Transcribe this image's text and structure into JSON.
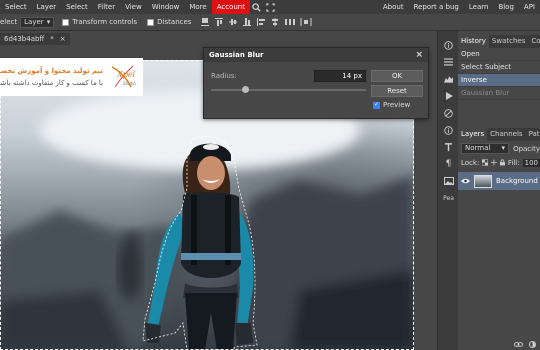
{
  "menu": {
    "items": [
      "Select",
      "Layer",
      "Select",
      "Filter",
      "View",
      "Window",
      "More",
      "Account"
    ],
    "right_items": [
      "About",
      "Report a bug",
      "Learn",
      "Blog",
      "API"
    ],
    "accent_color": "#dd1111"
  },
  "options_bar": {
    "left_label": "elect",
    "layer_select": "Layer",
    "transform_controls_label": "Transform controls",
    "distances_label": "Distances"
  },
  "document_tab": {
    "title": "6d43b4abff",
    "modified_marker": "*",
    "close": "×"
  },
  "logo": {
    "line1": "تیم تولید محتوا و آموزش تخصصی",
    "line2": "با ما کسب و کار متفاوت داشته باشید",
    "mark_text": "Xpel",
    "mark_sub": "Studio"
  },
  "dialog": {
    "title": "Gaussian Blur",
    "close": "×",
    "radius_label": "Radius:",
    "radius_value": "14 px",
    "slider_value": 0.22,
    "ok_label": "OK",
    "reset_label": "Reset",
    "preview_label": "Preview",
    "preview_checked": true
  },
  "side_tools": [
    "info-icon",
    "list-icon",
    "histogram-icon",
    "play-icon",
    "no-entry-icon",
    "info-circle-icon",
    "type-icon",
    "paragraph-icon",
    "image-icon",
    "Pea"
  ],
  "history_panel": {
    "tabs": [
      "History",
      "Swatches",
      "Colo"
    ],
    "active_tab": "History",
    "items": [
      {
        "label": "Open",
        "state": "normal"
      },
      {
        "label": "Select Subject",
        "state": "normal"
      },
      {
        "label": "Inverse",
        "state": "active"
      },
      {
        "label": "Gaussian Blur",
        "state": "dim"
      }
    ]
  },
  "layers_panel": {
    "tabs": [
      "Layers",
      "Channels",
      "Path"
    ],
    "active_tab": "Layers",
    "blend_mode": "Normal",
    "opacity_label": "Opacity",
    "lock_label": "Lock:",
    "fill_label": "Fill:",
    "fill_value": "100",
    "layer_name": "Background"
  }
}
